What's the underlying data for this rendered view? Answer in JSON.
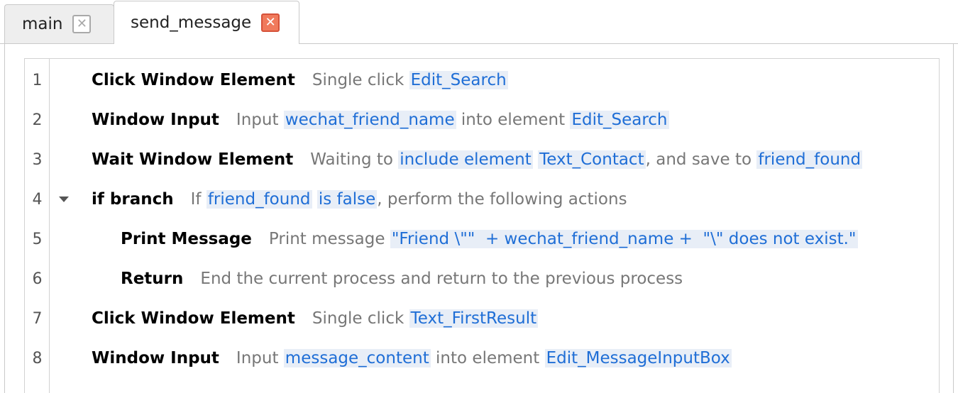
{
  "tabs": [
    {
      "label": "main",
      "active": false
    },
    {
      "label": "send_message",
      "active": true
    }
  ],
  "close_glyph": "✕",
  "fold_icon": "triangle-down",
  "colors": {
    "command": "#000000",
    "text": "#777777",
    "variable": "#1f6ed6",
    "variable_bg": "#e8eef7",
    "active_close": "#f07a5c"
  },
  "lines": [
    {
      "num": "1",
      "indent": 0,
      "fold": false,
      "command": "Click Window Element",
      "parts": [
        {
          "k": "t",
          "s": "Single click "
        },
        {
          "k": "v",
          "s": "Edit_Search"
        }
      ]
    },
    {
      "num": "2",
      "indent": 0,
      "fold": false,
      "command": "Window Input",
      "parts": [
        {
          "k": "t",
          "s": "Input "
        },
        {
          "k": "v",
          "s": "wechat_friend_name"
        },
        {
          "k": "t",
          "s": " into element "
        },
        {
          "k": "v",
          "s": "Edit_Search"
        }
      ]
    },
    {
      "num": "3",
      "indent": 0,
      "fold": false,
      "command": "Wait Window Element",
      "parts": [
        {
          "k": "t",
          "s": "Waiting to "
        },
        {
          "k": "v",
          "s": "include element"
        },
        {
          "k": "t",
          "s": " "
        },
        {
          "k": "v",
          "s": "Text_Contact"
        },
        {
          "k": "t",
          "s": ", and save to "
        },
        {
          "k": "v",
          "s": "friend_found"
        }
      ]
    },
    {
      "num": "4",
      "indent": 0,
      "fold": true,
      "command": "if branch",
      "parts": [
        {
          "k": "t",
          "s": "If "
        },
        {
          "k": "v",
          "s": "friend_found"
        },
        {
          "k": "t",
          "s": " "
        },
        {
          "k": "v",
          "s": "is false"
        },
        {
          "k": "t",
          "s": ", perform the following actions"
        }
      ]
    },
    {
      "num": "5",
      "indent": 1,
      "fold": false,
      "command": "Print Message",
      "parts": [
        {
          "k": "t",
          "s": "Print message "
        },
        {
          "k": "v",
          "s": "\"Friend \\\"\"  + wechat_friend_name +  \"\\\" does not exist.\""
        }
      ]
    },
    {
      "num": "6",
      "indent": 1,
      "fold": false,
      "command": "Return",
      "parts": [
        {
          "k": "t",
          "s": "End the current process and return to the previous process"
        }
      ]
    },
    {
      "num": "7",
      "indent": 0,
      "fold": false,
      "command": "Click Window Element",
      "parts": [
        {
          "k": "t",
          "s": "Single click "
        },
        {
          "k": "v",
          "s": "Text_FirstResult"
        }
      ]
    },
    {
      "num": "8",
      "indent": 0,
      "fold": false,
      "command": "Window Input",
      "parts": [
        {
          "k": "t",
          "s": "Input "
        },
        {
          "k": "v",
          "s": "message_content"
        },
        {
          "k": "t",
          "s": " into element "
        },
        {
          "k": "v",
          "s": "Edit_MessageInputBox"
        }
      ]
    }
  ]
}
